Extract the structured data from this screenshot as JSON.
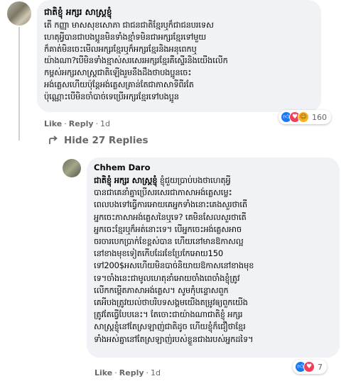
{
  "comment": {
    "author": "ជាតិខ្ញុំ អក្សរ សាស្ត្រខ្ញុំ",
    "body": "តើ កញ្ញា មាសសុខសោភា ជាជនជាតិខ្មែរឬក៏ជាជនបរទេស\nហេតុអ្វីបានជាបងប្អូនមិនទាំងខ្មាំទមិនជាអក្សរខ្មែរទៅមួយ\nក៏គាត់មិនចេះមើលអក្សរខ្មែរឬក៏អក្សរខ្មែរនិងអនុពេកឬ\nយ៉ាងណា?បើមិនទាំងខ្មាស់សរសេរអក្សរខ្មែរគឺស្ទើរនិងយើងលើក\nកម្ពស់អក្សរសាស្ត្រជាតិឡើងរួមនឹងដឹងថាបងប្អូនចេះ\nអង់គ្លេសហើយប៉ុន្តែអង់គ្លេសគ្រាន់តែជាភាសាទីពីរតែ\nប៉ុណ្ណោះបើមិនចាំបាច់ទេប្រើអក្សរខ្មែរទៅបងប្អូន",
    "actions": {
      "like": "Like",
      "reply": "Reply",
      "time": "1d"
    },
    "reaction_count": "160"
  },
  "hide_replies": "Hide 27 Replies",
  "reply": {
    "author": "Chhem Daro",
    "tag": "ជាតិខ្ញុំ អក្សរ សាស្ត្រខ្ញុំ",
    "body": " ខ្ញុំជួយប្រាប់បងថាហេតុអ្វី\nបានជាគេនាំគ្នាប្រើសរសេរជាភាសាអង់គ្លេសម្លេះ\nពេលបងទៅធ្វើការអោយគេអ្នកទាំងនោះគេងសួរថាតើ\nអ្នកចេះភាសាអង់គ្លេសនៃឬទេ? គេមិនសែលសួរថាតើ\nអ្នកចេះខ្មែរឬក៏អត់នោះទេ។ បើអ្នកចេះអង់គ្លេសអាច\nចរចារបេកប្រាក់ខែខ្ពស់បាន ហើយនៅមានឱកាសល្អ\nនៅខាងមុខទៀតកើបដែរខែប្រែកែអោយ150\nទៅ200$អសហើយមិនបាច់និយាយឱកាសនៅខាងមុខ\nទេ។ចាំងនេះជាមូលហេតុនាំអោយចាំងពេចាំងខ្ញុំត្រូវ\nលើកកម្ពើតភាសាអង់គ្លេស។ សូមកុំបន្ទោសពួក\nគេអីបងត្រូវយល់ថាបរិបទសង្គមយើងតម្រូវឲ្យពួកយើង\nត្រូវតែធ្វើបែបនេះ។ តែចោះជាយ៉ាងណាជាតិខ្ញុំ អក្សរ\nសាស្ត្រខ្ញុំនៅតែស្រឡាញ់ជាតិដូច ហើយខ្ញុំក៏ជឿថាខ្មែរ\nទាំងអស់គ្នានៅតែស្រឡាញ់របស់ខ្លួនជាងរបស់អ្នកដទៃ។",
    "actions": {
      "like": "Like",
      "reply": "Reply",
      "time": "1d"
    },
    "reaction_count": "7"
  },
  "icons": {
    "reactions_main": [
      "like-icon",
      "love-icon",
      "haha-icon"
    ],
    "reactions_reply": [
      "like-icon",
      "love-icon"
    ],
    "hide_arrow": "corner-up-arrow-icon"
  },
  "colors": {
    "bubble": "#f0f2f5",
    "meta": "#65676b",
    "like": "#1877f2",
    "love": "#f33e58",
    "haha": "#f7b125"
  }
}
